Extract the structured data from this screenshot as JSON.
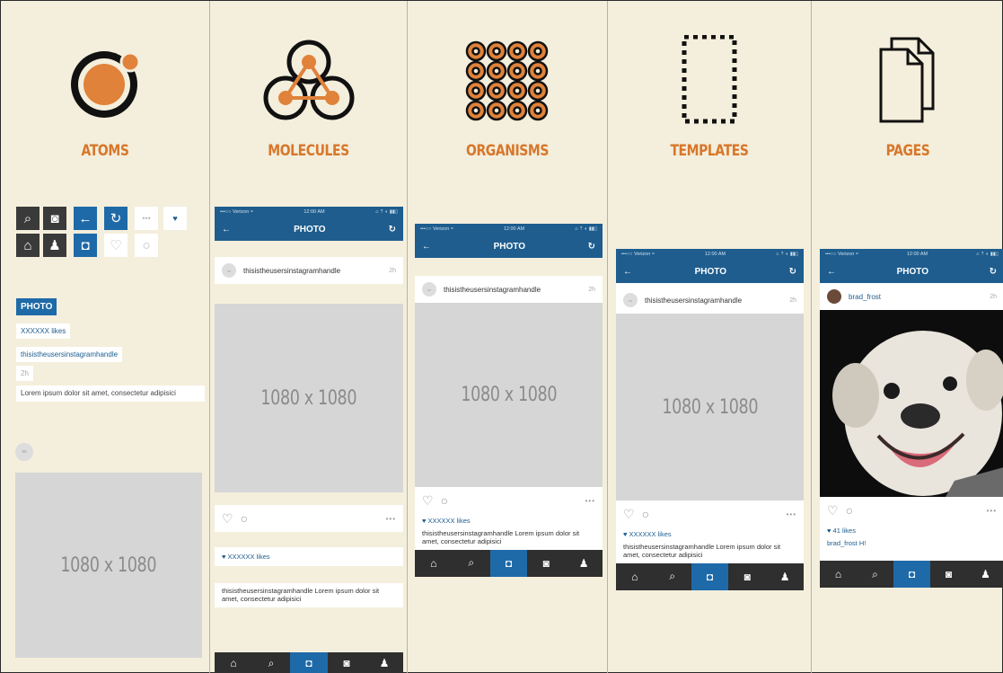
{
  "columns": [
    {
      "title": "ATOMS"
    },
    {
      "title": "MOLECULES"
    },
    {
      "title": "ORGANISMS"
    },
    {
      "title": "TEMPLATES"
    },
    {
      "title": "PAGES"
    }
  ],
  "colors": {
    "accent": "#d7772a",
    "brand_blue": "#1e5d8e",
    "panel_bg": "#f4eedc",
    "placeholder": "#d6d6d6"
  },
  "atoms": {
    "photo_label": "PHOTO",
    "likes_label": "XXXXXX likes",
    "handle": "thisistheusersinstagramhandle",
    "time": "2h",
    "caption": "Lorem ipsum dolor sit amet, consectetur adipisici",
    "avatar_text": "xx",
    "placeholder": "1080 x 1080"
  },
  "phone": {
    "carrier": "•••○○ Verizon ≈",
    "time": "12:00 AM",
    "battery": "⌂ ⇡ ◐ ▮▮▯",
    "title": "PHOTO",
    "handle": "thisistheusersinstagramhandle",
    "post_time": "2h",
    "placeholder": "1080 x 1080",
    "likes": "♥ XXXXXX likes",
    "caption": "thisistheusersinstagramhandle Lorem ipsum dolor sit amet, consectetur adipisici"
  },
  "molecules": {
    "likes": "♥ XXXXXX likes",
    "caption": "thisistheusersinstagramhandle Lorem ipsum dolor sit amet, consectetur adipisici"
  },
  "page": {
    "time": "12:00 AM",
    "handle": "brad_frost",
    "post_time": "2h",
    "likes": "♥ 41 likes",
    "caption": "brad_frost H!"
  }
}
